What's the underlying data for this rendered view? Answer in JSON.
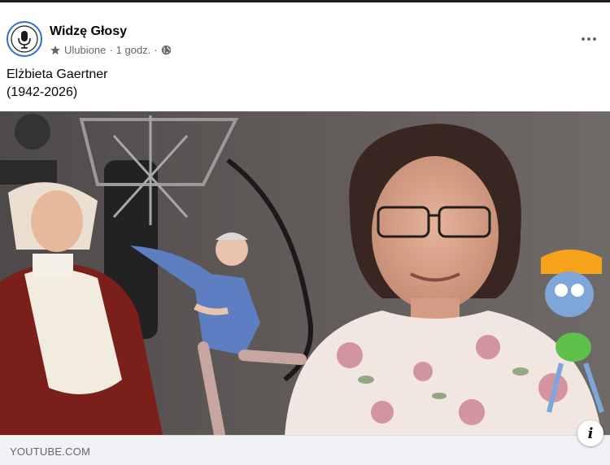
{
  "post": {
    "page_name": "Widzę Głosy",
    "favorite_label": "Ulubione",
    "separator": "·",
    "time": "1 godz.",
    "text_line1": "Elżbieta Gaertner",
    "text_line2": "(1942-2026)"
  },
  "link": {
    "domain": "YOUTUBE.COM",
    "info_label": "i"
  },
  "icons": {
    "avatar": "microphone-logo-icon",
    "favorite": "star-icon",
    "audience": "globe-icon",
    "more": "more-options-icon",
    "info": "info-icon"
  },
  "colors": {
    "text_primary": "#050505",
    "text_secondary": "#65676b",
    "link_bar_bg": "#f0f2f5",
    "avatar_ring": "#2d6fd6"
  }
}
